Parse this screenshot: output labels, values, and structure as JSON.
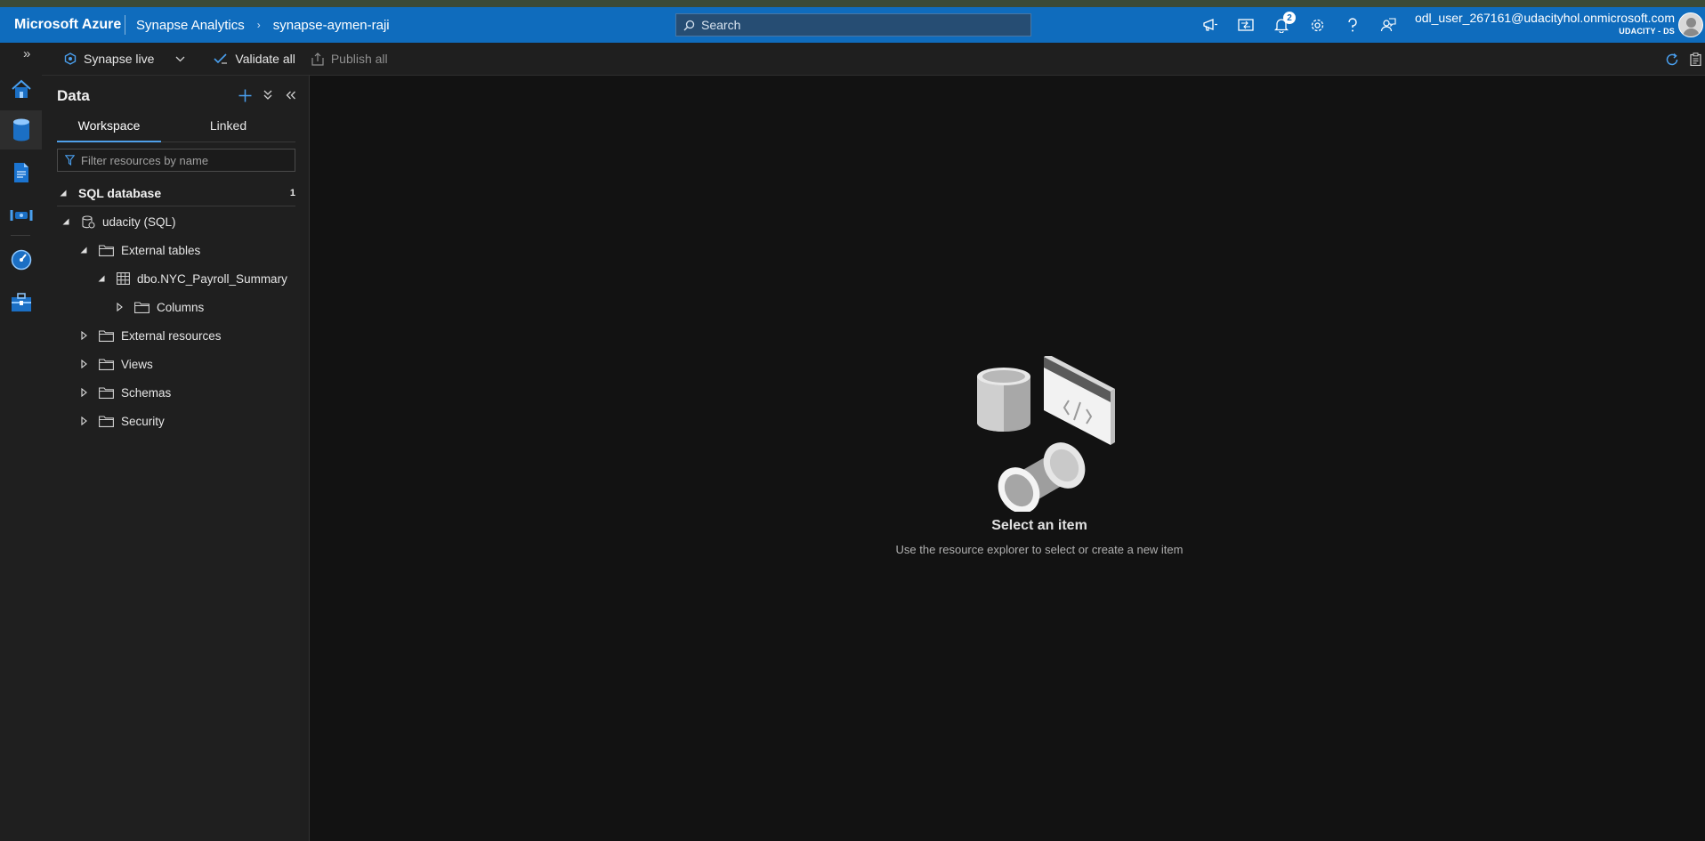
{
  "header": {
    "brand": "Microsoft Azure",
    "crumbs": [
      "Synapse Analytics",
      "synapse-aymen-raji"
    ],
    "crumb_separator": "›",
    "search_placeholder": "Search",
    "notification_count": "2",
    "user_email": "odl_user_267161@udacityhol.onmicrosoft.com",
    "user_org": "UDACITY - DS",
    "accent_color": "#0f6cbd"
  },
  "rail": {
    "expand_label": "»",
    "items": [
      "home-icon",
      "data-icon",
      "develop-icon",
      "integrate-icon",
      "monitor-icon",
      "manage-icon"
    ]
  },
  "toolbar": {
    "mode_label": "Synapse live",
    "validate_label": "Validate all",
    "publish_label": "Publish all"
  },
  "pane": {
    "title": "Data",
    "tabs": [
      "Workspace",
      "Linked"
    ],
    "active_tab": "Workspace",
    "filter_placeholder": "Filter resources by name",
    "section_label": "SQL database",
    "section_count": "1",
    "tree": [
      {
        "label": "udacity (SQL)",
        "level": 1,
        "expanded": true,
        "icon": "sql-database-icon"
      },
      {
        "label": "External tables",
        "level": 2,
        "expanded": true,
        "icon": "folder-icon"
      },
      {
        "label": "dbo.NYC_Payroll_Summary",
        "level": 3,
        "expanded": true,
        "icon": "table-icon"
      },
      {
        "label": "Columns",
        "level": 4,
        "expanded": false,
        "icon": "folder-icon"
      },
      {
        "label": "External resources",
        "level": 2,
        "expanded": false,
        "icon": "folder-icon"
      },
      {
        "label": "Views",
        "level": 2,
        "expanded": false,
        "icon": "folder-icon"
      },
      {
        "label": "Schemas",
        "level": 2,
        "expanded": false,
        "icon": "folder-icon"
      },
      {
        "label": "Security",
        "level": 2,
        "expanded": false,
        "icon": "folder-icon"
      }
    ]
  },
  "empty_state": {
    "title": "Select an item",
    "subtitle": "Use the resource explorer to select or create a new item"
  }
}
